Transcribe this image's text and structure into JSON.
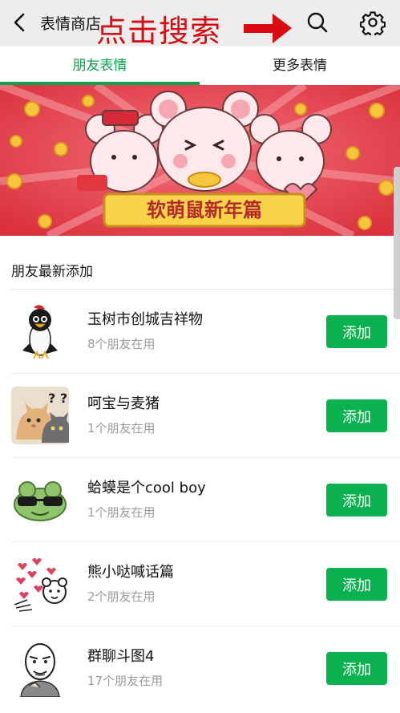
{
  "header": {
    "title": "表情商店",
    "annotation": "点击搜索",
    "back_icon": "chevron-left-icon",
    "search_icon": "search-icon",
    "settings_icon": "gear-icon"
  },
  "tabs": [
    {
      "label": "朋友表情",
      "active": true
    },
    {
      "label": "更多表情",
      "active": false
    }
  ],
  "banner": {
    "caption": "软萌鼠新年篇"
  },
  "section": {
    "title": "朋友最新添加"
  },
  "items": [
    {
      "name": "玉树市创城吉祥物",
      "count": "8个朋友在用",
      "button": "添加",
      "icon": "bird-mascot-icon"
    },
    {
      "name": "呵宝与麦猪",
      "count": "1个朋友在用",
      "button": "添加",
      "icon": "cats-icon"
    },
    {
      "name": "蛤蟆是个cool boy",
      "count": "1个朋友在用",
      "button": "添加",
      "icon": "frog-sunglasses-icon"
    },
    {
      "name": "熊小哒喊话篇",
      "count": "2个朋友在用",
      "button": "添加",
      "icon": "bear-hearts-icon"
    },
    {
      "name": "群聊斗图4",
      "count": "17个朋友在用",
      "button": "添加",
      "icon": "meme-face-icon"
    }
  ],
  "colors": {
    "accent": "#07a34c",
    "button": "#09b24e",
    "annotation": "#d80c12",
    "banner_red": "#e8414a"
  }
}
